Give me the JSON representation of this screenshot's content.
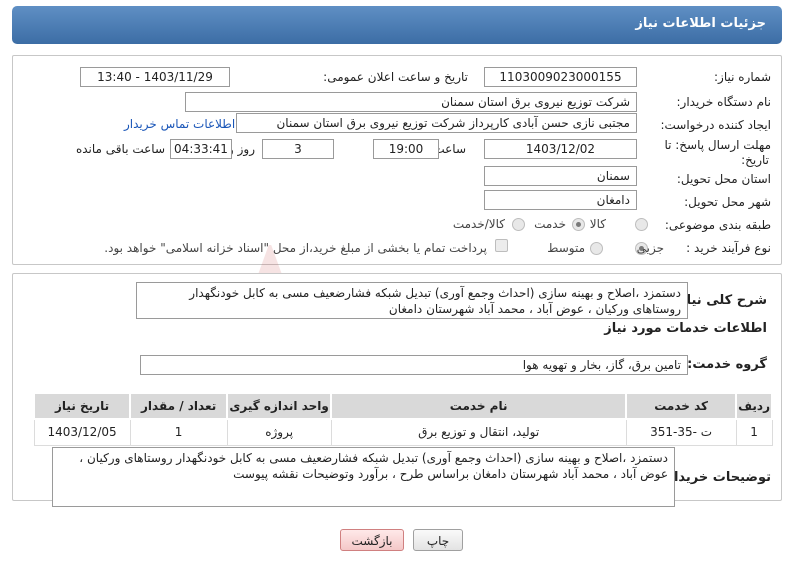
{
  "header": {
    "title": "جزئیات اطلاعات نیاز"
  },
  "need_info": {
    "need_number_label": "شماره نیاز:",
    "need_number": "1103009023000155",
    "announce_label": "تاریخ و ساعت اعلان عمومی:",
    "announce_value": "1403/11/29 - 13:40",
    "buyer_org_label": "نام دستگاه خریدار:",
    "buyer_org": "شرکت توزیع نیروی برق استان سمنان",
    "creator_label": "ایجاد کننده درخواست:",
    "creator": "مجتبی نازی حسن آبادی کارپرداز شرکت توزیع نیروی برق استان سمنان",
    "contact_link": "اطلاعات تماس خریدار",
    "deadline_label_1": "مهلت ارسال پاسخ: تا",
    "deadline_label_2": "تاریخ:",
    "deadline_date": "1403/12/02",
    "time_label": "ساعت",
    "deadline_time": "19:00",
    "days_value": "3",
    "days_label": "روز و",
    "remaining_time": "04:33:41",
    "remaining_label": "ساعت باقی مانده",
    "province_label": "استان محل تحویل:",
    "province": "سمنان",
    "city_label": "شهر محل تحویل:",
    "city": "دامغان",
    "category_label": "طبقه بندی موضوعی:",
    "category_options": [
      "کالا",
      "خدمت",
      "کالا/خدمت"
    ],
    "category_selected": "خدمت",
    "process_label": "نوع فرآیند خرید :",
    "process_options": [
      "جزیی",
      "متوسط"
    ],
    "process_selected": "جزیی",
    "payment_note": "پرداخت تمام یا بخشی از مبلغ خرید،از محل \"اسناد خزانه اسلامی\" خواهد بود."
  },
  "summary": {
    "label": "شرح کلی نیاز:",
    "text": "دستمزد ،اصلاح و بهینه سازی (احداث وجمع آوری) تبدیل شبکه فشارضعیف مسی به کابل خودنگهدار روستاهای ورکیان ، عوض آباد ، محمد آباد شهرستان دامغان"
  },
  "services": {
    "section_title": "اطلاعات خدمات مورد نیاز",
    "group_label": "گروه خدمت:",
    "group_value": "تامین برق، گاز، بخار و تهویه هوا",
    "columns": [
      "ردیف",
      "کد خدمت",
      "نام خدمت",
      "واحد اندازه گیری",
      "تعداد / مقدار",
      "تاریخ نیاز"
    ],
    "rows": [
      [
        "1",
        "ت -35-351",
        "تولید، انتقال و توزیع برق",
        "پروژه",
        "1",
        "1403/12/05"
      ]
    ]
  },
  "buyer_notes": {
    "label": "توضیحات خریدار:",
    "text": "دستمزد ،اصلاح و بهینه سازی (احداث وجمع آوری) تبدیل شبکه فشارضعیف مسی به کابل خودنگهدار روستاهای ورکیان ، عوض آباد ، محمد آباد شهرستان دامغان براساس طرح ، برآورد وتوضیحات نقشه پیوست"
  },
  "buttons": {
    "print": "چاپ",
    "back": "بازگشت"
  },
  "colors": {
    "header": "#4a7bb4",
    "link": "#1a56b8",
    "table_header": "#d9d9d9"
  }
}
